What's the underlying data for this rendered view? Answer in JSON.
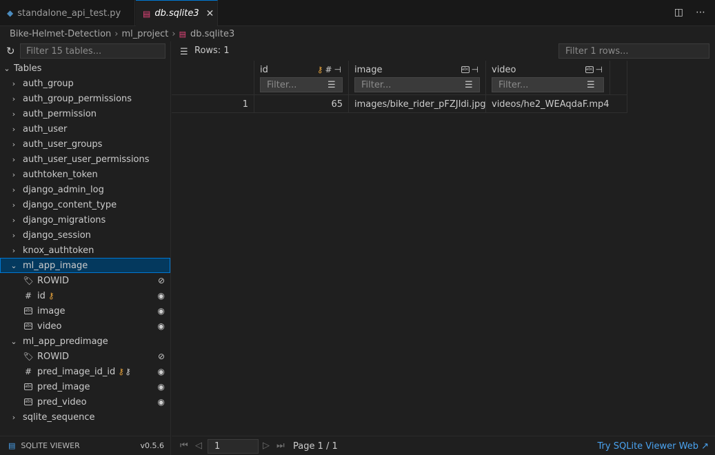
{
  "tabs": [
    {
      "label": "standalone_api_test.py",
      "active": false
    },
    {
      "label": "db.sqlite3",
      "active": true,
      "close": "✕"
    }
  ],
  "breadcrumb": [
    "Bike-Helmet-Detection",
    "ml_project",
    "db.sqlite3"
  ],
  "sidebar": {
    "filter_placeholder": "Filter 15 tables...",
    "tables_label": "Tables",
    "tables": [
      "auth_group",
      "auth_group_permissions",
      "auth_permission",
      "auth_user",
      "auth_user_groups",
      "auth_user_user_permissions",
      "authtoken_token",
      "django_admin_log",
      "django_content_type",
      "django_migrations",
      "django_session",
      "knox_authtoken"
    ],
    "expanded": [
      {
        "name": "ml_app_image",
        "columns": [
          "ROWID",
          "id",
          "image",
          "video"
        ]
      },
      {
        "name": "ml_app_predimage",
        "columns": [
          "ROWID",
          "pred_image_id_id",
          "pred_image",
          "pred_video"
        ]
      }
    ],
    "last_table": "sqlite_sequence",
    "footer_title": "SQLITE VIEWER",
    "footer_version": "v0.5.6"
  },
  "toolbar": {
    "rows_label": "Rows: 1",
    "filter_placeholder": "Filter 1 rows..."
  },
  "grid": {
    "columns": [
      {
        "name": "id",
        "filter_placeholder": "Filter..."
      },
      {
        "name": "image",
        "filter_placeholder": "Filter..."
      },
      {
        "name": "video",
        "filter_placeholder": "Filter..."
      }
    ],
    "rows": [
      {
        "num": "1",
        "id": "65",
        "image": "images/bike_rider_pFZJIdi.jpg",
        "video": "videos/he2_WEAqdaF.mp4"
      }
    ]
  },
  "pager": {
    "page_value": "1",
    "page_label": "Page 1 / 1",
    "try_link": "Try SQLite Viewer Web ↗"
  },
  "colors": {
    "accent": "#0078d4",
    "selected_bg": "#04395e",
    "key": "#e6a23c",
    "link": "#4aa3f0",
    "db_icon": "#e8467c",
    "py_icon": "#4b8bbe"
  }
}
